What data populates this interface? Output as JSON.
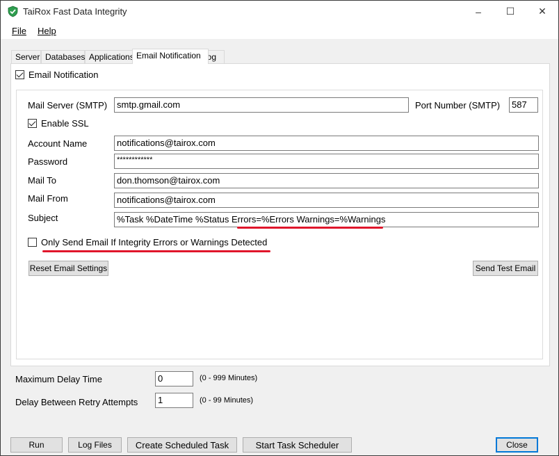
{
  "window": {
    "title": "TaiRox Fast Data Integrity",
    "app_icon": "shield-check-icon",
    "controls": {
      "minimize": "–",
      "maximize": "☐",
      "close": "✕"
    }
  },
  "menu": [
    {
      "label": "File",
      "underline_index": 0
    },
    {
      "label": "Help",
      "underline_index": 0
    }
  ],
  "tabs": [
    {
      "label": "Server",
      "active": false
    },
    {
      "label": "Databases",
      "active": false
    },
    {
      "label": "Applications",
      "active": false
    },
    {
      "label": "Email Notification",
      "active": true
    },
    {
      "label": "Log",
      "active": false
    }
  ],
  "email": {
    "enable_label": "Email Notification",
    "enable_checked": true,
    "mail_server_label": "Mail Server (SMTP)",
    "mail_server_value": "smtp.gmail.com",
    "port_label": "Port Number (SMTP)",
    "port_value": "587",
    "ssl_label": "Enable SSL",
    "ssl_checked": true,
    "account_label": "Account Name",
    "account_value": "notifications@tairox.com",
    "password_label": "Password",
    "password_value": "************",
    "mail_to_label": "Mail To",
    "mail_to_value": "don.thomson@tairox.com",
    "mail_from_label": "Mail From",
    "mail_from_value": "notifications@tairox.com",
    "subject_label": "Subject",
    "subject_value": "%Task %DateTime %Status Errors=%Errors Warnings=%Warnings",
    "only_errors_label": "Only Send Email If Integrity Errors or Warnings Detected",
    "only_errors_checked": false,
    "reset_button": "Reset Email Settings",
    "test_button": "Send Test Email"
  },
  "delays": {
    "max_delay_label": "Maximum Delay Time",
    "max_delay_value": "0",
    "max_delay_hint": "(0 - 999 Minutes)",
    "retry_label": "Delay Between Retry Attempts",
    "retry_value": "1",
    "retry_hint": "(0 - 99 Minutes)"
  },
  "footer": {
    "run": "Run",
    "log_files": "Log Files",
    "create_task": "Create Scheduled Task",
    "start_scheduler": "Start Task Scheduler",
    "close": "Close"
  },
  "colors": {
    "annotation": "#e0162b",
    "focus": "#0078d7"
  }
}
